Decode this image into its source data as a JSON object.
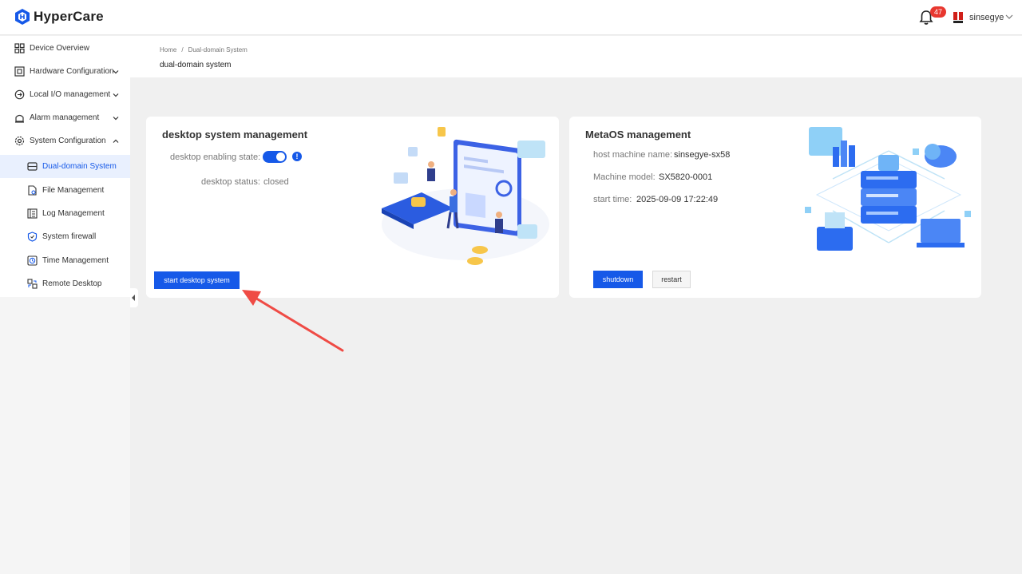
{
  "app": {
    "name": "HyperCare"
  },
  "header": {
    "notification_count": "47",
    "user_name": "sinsegye"
  },
  "sidebar": {
    "items": [
      {
        "label": "Device Overview",
        "icon": "grid-icon"
      },
      {
        "label": "Hardware Configuration",
        "icon": "hardware-icon",
        "expandable": true
      },
      {
        "label": "Local I/O management",
        "icon": "io-icon",
        "expandable": true
      },
      {
        "label": "Alarm management",
        "icon": "alarm-icon",
        "expandable": true
      },
      {
        "label": "System Configuration",
        "icon": "settings-icon",
        "expandable": true,
        "expanded": true
      },
      {
        "label": "Dual-domain System",
        "icon": "dual-domain-icon",
        "active": true
      },
      {
        "label": "File Management",
        "icon": "file-icon"
      },
      {
        "label": "Log Management",
        "icon": "log-icon"
      },
      {
        "label": "System firewall",
        "icon": "shield-icon"
      },
      {
        "label": "Time Management",
        "icon": "clock-icon"
      },
      {
        "label": "Remote Desktop",
        "icon": "remote-desktop-icon"
      }
    ]
  },
  "breadcrumb": {
    "home": "Home",
    "separator": "/",
    "current": "Dual-domain System"
  },
  "page_title": "dual-domain system",
  "desktop_card": {
    "title": "desktop system management",
    "enabling_label": "desktop enabling state:",
    "enabling_state": true,
    "status_label": "desktop status:",
    "status_value": "closed",
    "start_button": "start desktop system"
  },
  "metaos_card": {
    "title": "MetaOS management",
    "host_label": "host machine name:",
    "host_value": "sinsegye-sx58",
    "model_label": "Machine model:",
    "model_value": "SX5820-0001",
    "start_label": "start time:",
    "start_value": "2025-09-09 17:22:49",
    "shutdown_button": "shutdown",
    "restart_button": "restart"
  },
  "colors": {
    "primary": "#1659e8",
    "badge": "#e8372f",
    "annotation_arrow": "#ef4b45"
  }
}
